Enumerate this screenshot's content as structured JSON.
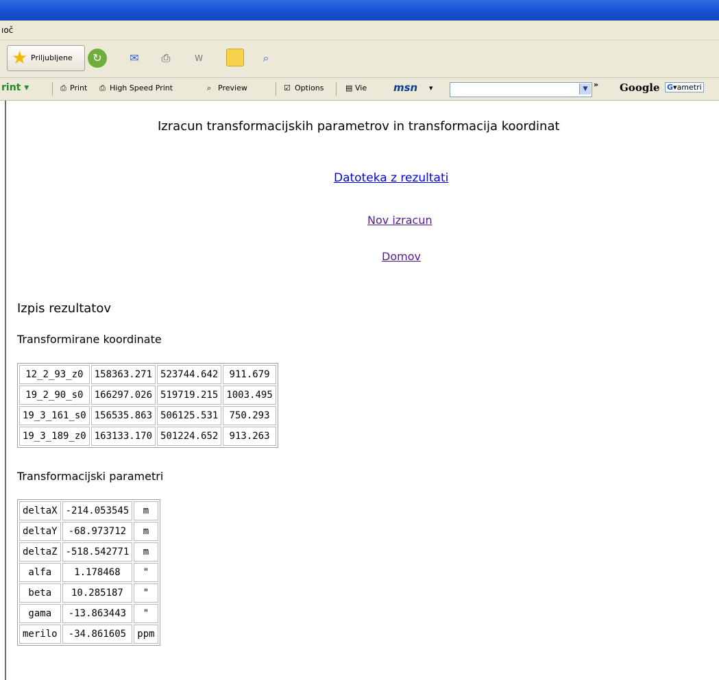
{
  "menubar": {
    "partial_item": "ıoč"
  },
  "toolbar1": {
    "favorites_label": "Priljubljene"
  },
  "toolbar2": {
    "print_menu": "rint ▾",
    "print_button": "Print",
    "high_speed_print": "High Speed Print",
    "preview": "Preview",
    "options": "Options",
    "view_partial": "Vie",
    "msn": "msn",
    "chevron": "»",
    "google": "Google",
    "search_partial": "ametri"
  },
  "page": {
    "title": "Izracun transformacijskih parametrov in transformacija koordinat",
    "links": {
      "results_file": "Datoteka z rezultati",
      "new_calc": "Nov izracun",
      "home": "Domov"
    },
    "results_heading": "Izpis rezultatov",
    "coords_heading": "Transformirane koordinate",
    "params_heading": "Transformacijski parametri"
  },
  "coords": [
    [
      "12_2_93_z0",
      "158363.271",
      "523744.642",
      "911.679"
    ],
    [
      "19_2_90_s0",
      "166297.026",
      "519719.215",
      "1003.495"
    ],
    [
      "19_3_161_s0",
      "156535.863",
      "506125.531",
      "750.293"
    ],
    [
      "19_3_189_z0",
      "163133.170",
      "501224.652",
      "913.263"
    ]
  ],
  "params": [
    [
      "deltaX",
      "-214.053545",
      "m"
    ],
    [
      "deltaY",
      "-68.973712",
      "m"
    ],
    [
      "deltaZ",
      "-518.542771",
      "m"
    ],
    [
      "alfa",
      "1.178468",
      "\""
    ],
    [
      "beta",
      "10.285187",
      "\""
    ],
    [
      "gama",
      "-13.863443",
      "\""
    ],
    [
      "merilo",
      "-34.861605",
      "ppm"
    ]
  ]
}
